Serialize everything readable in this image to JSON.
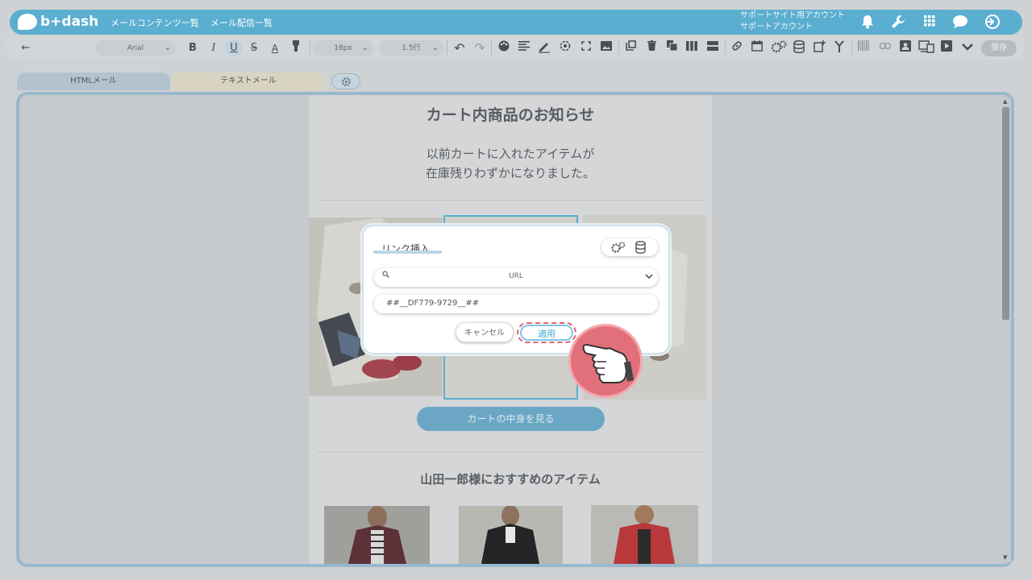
{
  "header": {
    "logo_text": "b+dash",
    "nav": [
      "メールコンテンツ一覧",
      "メール配信一覧"
    ],
    "account_line1": "サポートサイト用アカウント",
    "account_line2": "サポートアカウント",
    "icons": [
      "bell-icon",
      "wrench-icon",
      "apps-grid-icon",
      "brain-icon",
      "logout-icon"
    ]
  },
  "toolbar": {
    "back_glyph": "←",
    "font_family": "Arial",
    "font_size": "18px",
    "line_height": "1.5行",
    "save_label": "保存"
  },
  "tabs": {
    "html": "HTMLメール",
    "text": "テキストメール"
  },
  "mail": {
    "title": "カート内商品のお知らせ",
    "lead_line1": "以前カートに入れたアイテムが",
    "lead_line2": "在庫残りわずかになりました。",
    "cart_button": "カートの中身を見る",
    "recommend_title": "山田一郎様におすすめのアイテム"
  },
  "dialog": {
    "title": "リンク挿入",
    "select_value": "URL",
    "url_value": "##__DF779-9729__##",
    "cancel_label": "キャンセル",
    "apply_label": "適用"
  },
  "colors": {
    "brand": "#5aaed0",
    "highlight": "#e2606d",
    "accent": "#3fa7d6"
  }
}
